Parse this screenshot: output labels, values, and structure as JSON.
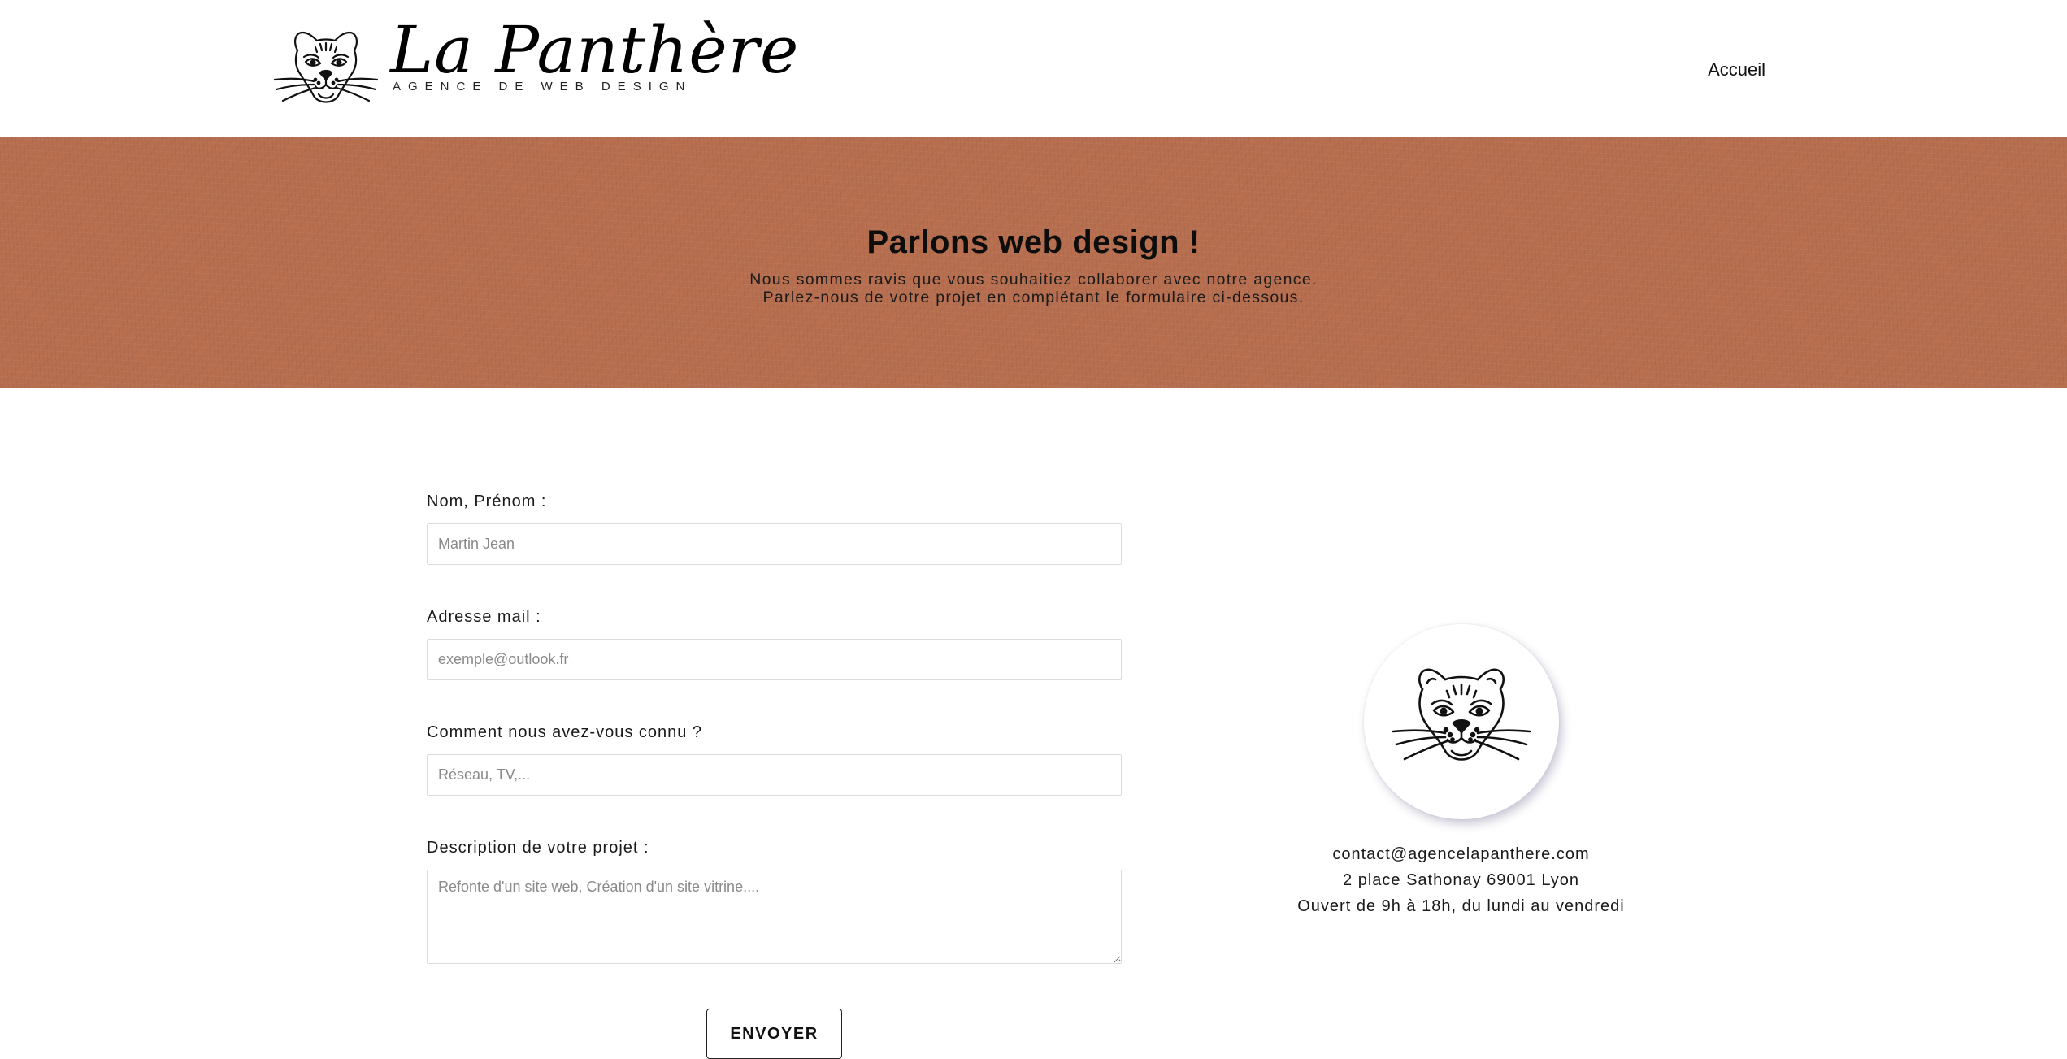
{
  "header": {
    "logo_title": "La Panthère",
    "logo_subtitle": "AGENCE DE WEB DESIGN",
    "nav_home": "Accueil"
  },
  "hero": {
    "title": "Parlons web design !",
    "line1": "Nous sommes ravis que vous souhaitiez collaborer avec notre agence.",
    "line2": "Parlez-nous de votre projet en complétant le formulaire ci-dessous.",
    "background_color": "#b86f50"
  },
  "form": {
    "name_label": "Nom, Prénom :",
    "name_placeholder": "Martin Jean",
    "email_label": "Adresse mail :",
    "email_placeholder": "exemple@outlook.fr",
    "source_label": "Comment nous avez-vous connu ?",
    "source_placeholder": "Réseau, TV,...",
    "description_label": "Description de votre projet :",
    "description_placeholder": "Refonte d'un site web, Création d'un site vitrine,...",
    "submit_label": "ENVOYER"
  },
  "contact": {
    "icon": "panther-head-icon",
    "email": "contact@agencelapanthere.com",
    "address": "2 place Sathonay 69001 Lyon",
    "hours": "Ouvert de 9h à 18h, du lundi au vendredi"
  }
}
